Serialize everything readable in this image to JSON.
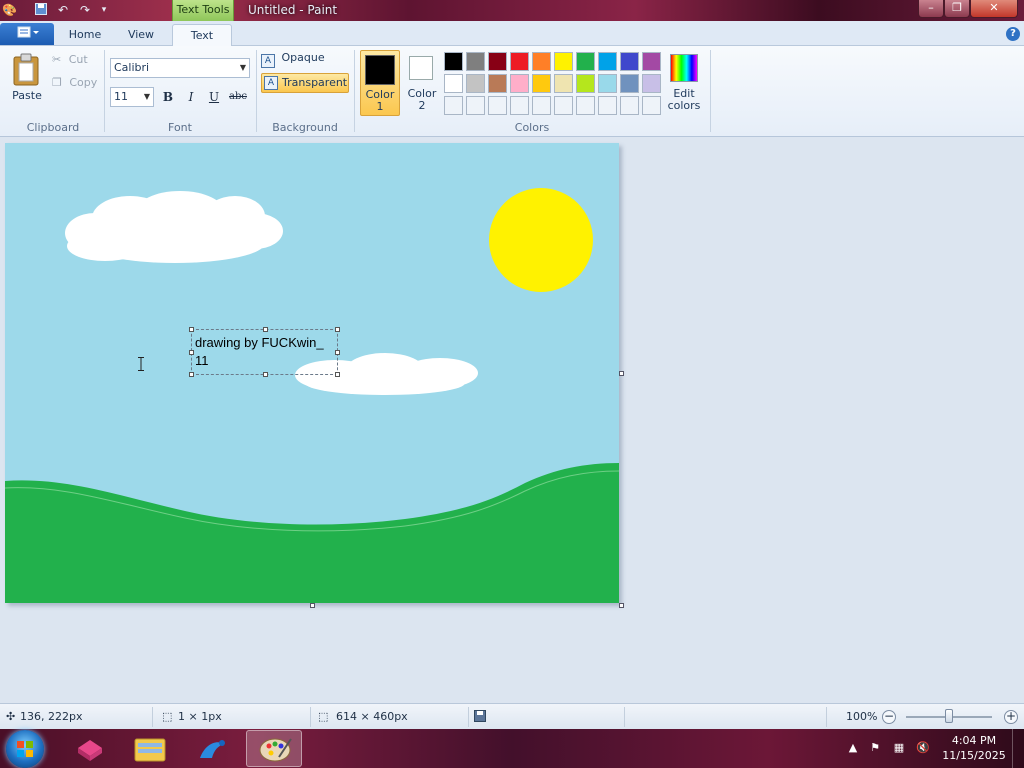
{
  "titlebar": {
    "context_tab": "Text Tools",
    "title": "Untitled - Paint",
    "minimize_glyph": "–",
    "maximize_glyph": "❐",
    "close_glyph": "✕"
  },
  "tabs": [
    {
      "label": "Home",
      "active": false
    },
    {
      "label": "View",
      "active": false
    },
    {
      "label": "Text",
      "active": true
    }
  ],
  "clipboard": {
    "paste": "Paste",
    "cut": "Cut",
    "copy": "Copy",
    "group": "Clipboard"
  },
  "font": {
    "family": "Calibri",
    "size": "11",
    "bold": "B",
    "italic": "I",
    "underline": "U",
    "strike": "abc",
    "group": "Font"
  },
  "background": {
    "opaque": "Opaque",
    "transparent": "Transparent",
    "group": "Background"
  },
  "colors": {
    "color1_line1": "Color",
    "color1_line2": "1",
    "color2_line1": "Color",
    "color2_line2": "2",
    "edit_line1": "Edit",
    "edit_line2": "colors",
    "group": "Colors",
    "color1_value": "#000000",
    "color2_value": "#ffffff",
    "palette_row1": [
      "#000000",
      "#7f7f7f",
      "#880015",
      "#ed1c24",
      "#ff7f27",
      "#fff200",
      "#22b14c",
      "#00a2e8",
      "#3f48cc",
      "#a349a4"
    ],
    "palette_row2": [
      "#ffffff",
      "#c3c3c3",
      "#b97a57",
      "#ffaec9",
      "#ffc90e",
      "#efe4b0",
      "#b5e61d",
      "#99d9ea",
      "#7092be",
      "#c8bfe7"
    ]
  },
  "canvas": {
    "text_line1": "drawing by FUCKwin_",
    "text_line2": "11",
    "sky_color": "#9dd9ea",
    "grass_color": "#22b14c",
    "sun_color": "#fff200"
  },
  "statusbar": {
    "cursor_pos": "136, 222px",
    "selection_size": "1 × 1px",
    "image_size": "614 × 460px",
    "zoom": "100%"
  },
  "taskbar": {
    "time": "4:04 PM",
    "date": "11/15/2025"
  }
}
